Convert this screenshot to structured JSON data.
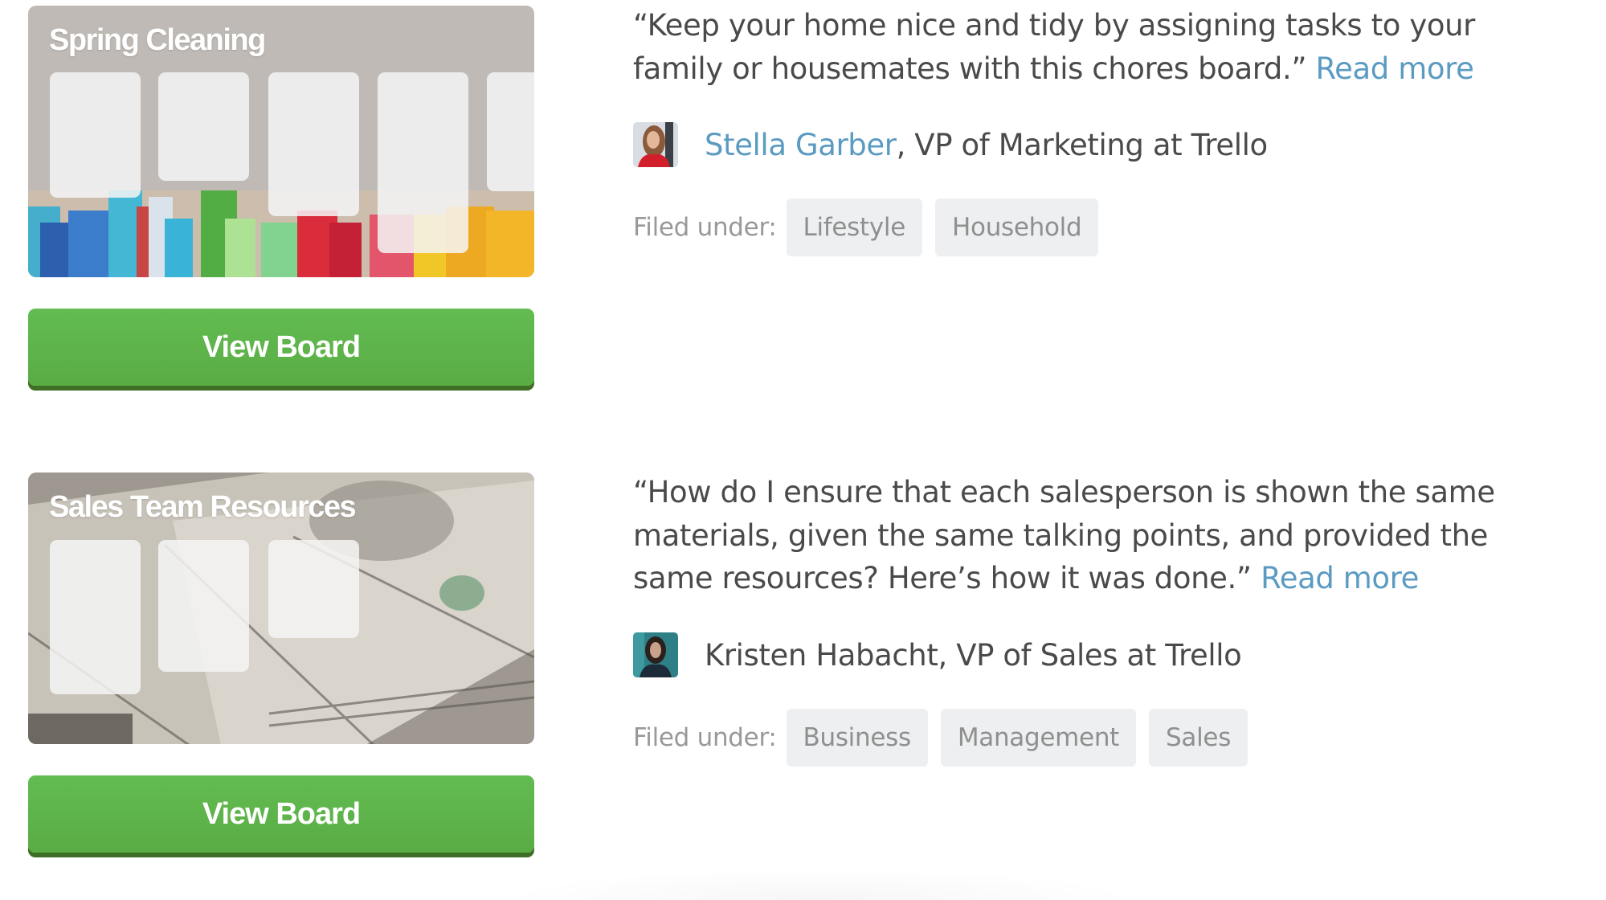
{
  "entries": [
    {
      "board": {
        "title": "Spring Cleaning",
        "image": "cleaning-bottles-photo",
        "list_count": 5
      },
      "button_label": "View Board",
      "quote": "“Keep your home nice and tidy by assigning tasks to your family or housemates with this chores board.”",
      "read_more": "Read more",
      "author": {
        "name": "Stella Garber",
        "name_is_link": true,
        "title": ", VP of Marketing at Trello",
        "avatar": "stella-garber-avatar"
      },
      "filed_label": "Filed under:",
      "tags": [
        "Lifestyle",
        "Household"
      ]
    },
    {
      "board": {
        "title": "Sales Team Resources",
        "image": "dollar-bills-photo",
        "list_count": 3
      },
      "button_label": "View Board",
      "quote": "“How do I ensure that each salesperson is shown the same materials, given the same talking points, and provided the same resources? Here’s how it was done.”",
      "read_more": "Read more",
      "author": {
        "name": "Kristen Habacht",
        "name_is_link": false,
        "title": ", VP of Sales at Trello",
        "avatar": "kristen-habacht-avatar"
      },
      "filed_label": "Filed under:",
      "tags": [
        "Business",
        "Management",
        "Sales"
      ]
    }
  ],
  "colors": {
    "link": "#5b9bc2",
    "button_green": "#5aac44",
    "button_shadow": "#3f6e25",
    "tag_bg": "#edeff0",
    "text": "#4a4a4a"
  }
}
